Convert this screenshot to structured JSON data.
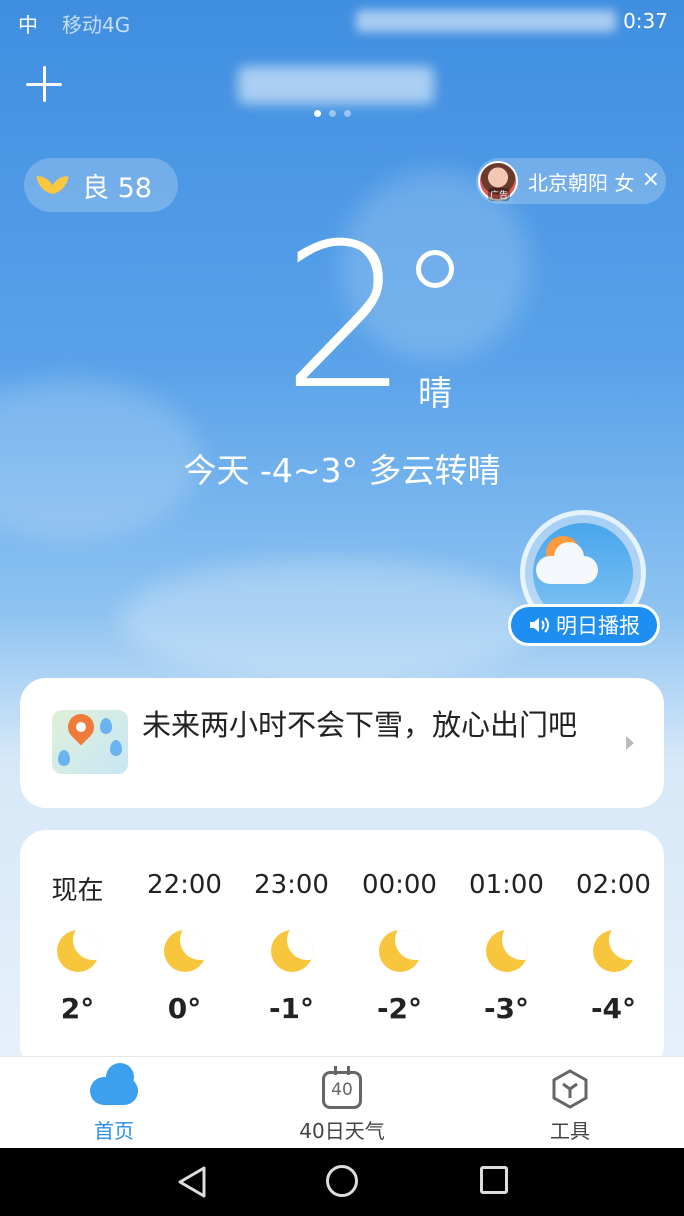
{
  "status_bar": {
    "carrier": "中",
    "network": "移动4G",
    "time": "0:37"
  },
  "header": {
    "add_icon": "plus-icon",
    "page_dots_total": 3,
    "page_dots_active": 1
  },
  "aqi": {
    "label": "良 58",
    "icon": "leaf-icon"
  },
  "ad": {
    "text": "北京朝阳 女",
    "tag": "广告",
    "close_label": "×"
  },
  "current": {
    "temperature": "2",
    "condition": "晴",
    "today_summary": "今天 -4~3°  多云转晴"
  },
  "tomorrow_broadcast": {
    "label": "明日播报",
    "icon": "speaker-icon"
  },
  "notice": {
    "text": "未来两小时不会下雪，放心出门吧",
    "icon": "map-pin-icon"
  },
  "hourly": [
    {
      "time": "现在",
      "temp": "2°",
      "icon": "moon-icon"
    },
    {
      "time": "22:00",
      "temp": "0°",
      "icon": "moon-icon"
    },
    {
      "time": "23:00",
      "temp": "-1°",
      "icon": "moon-icon"
    },
    {
      "time": "00:00",
      "temp": "-2°",
      "icon": "moon-icon"
    },
    {
      "time": "01:00",
      "temp": "-3°",
      "icon": "moon-icon"
    },
    {
      "time": "02:00",
      "temp": "-4°",
      "icon": "moon-icon"
    }
  ],
  "tabs": [
    {
      "label": "首页",
      "icon": "cloud-icon",
      "active": true
    },
    {
      "label": "40日天气",
      "icon": "calendar-icon",
      "calendar_number": "40",
      "active": false
    },
    {
      "label": "工具",
      "icon": "toolbox-icon",
      "active": false
    }
  ],
  "colors": {
    "accent": "#2b8fe8",
    "sky_top": "#3f8ee0",
    "sun": "#f8c63c"
  }
}
